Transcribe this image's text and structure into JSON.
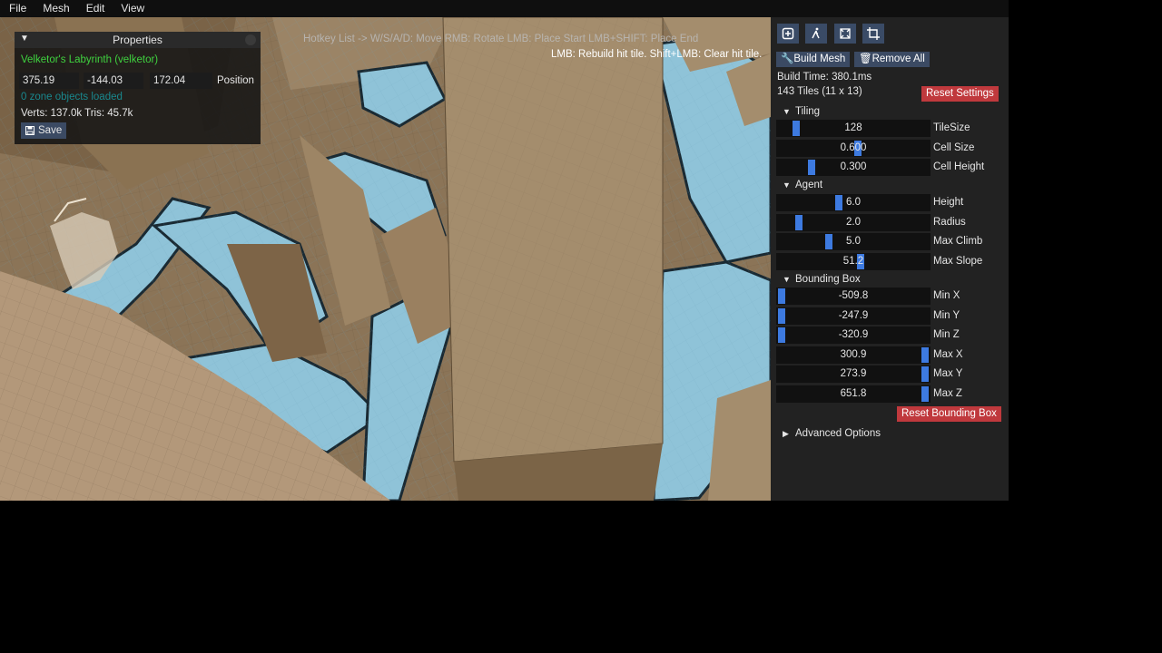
{
  "menu": [
    "File",
    "Mesh",
    "Edit",
    "View"
  ],
  "viewport": {
    "hint_top": "Hotkey List -> W/S/A/D: Move  RMB: Rotate  LMB: Place Start  LMB+SHIFT: Place End",
    "hint_tool": "LMB: Rebuild hit tile.  Shift+LMB: Clear hit tile."
  },
  "properties": {
    "title": "Properties",
    "zone_name": "Velketor's Labyrinth (velketor)",
    "pos_x": "375.19",
    "pos_y": "-144.03",
    "pos_z": "172.04",
    "position_label": "Position",
    "zone_objects": "0 zone objects loaded",
    "stats": "Verts: 137.0k Tris: 45.7k",
    "save_label": "Save"
  },
  "panel": {
    "build_mesh": "Build Mesh",
    "remove_all": "Remove All",
    "build_time": "Build Time: 380.1ms",
    "tiles": "143 Tiles (11 x 13)",
    "reset_settings": "Reset Settings",
    "tiling_header": "Tiling",
    "agent_header": "Agent",
    "bbox_header": "Bounding Box",
    "reset_bbox": "Reset Bounding Box",
    "advanced": "Advanced Options",
    "tiling": [
      {
        "label": "TileSize",
        "value": "128",
        "fraction": 0.1
      },
      {
        "label": "Cell Size",
        "value": "0.600",
        "fraction": 0.53
      },
      {
        "label": "Cell Height",
        "value": "0.300",
        "fraction": 0.21
      }
    ],
    "agent": [
      {
        "label": "Height",
        "value": "6.0",
        "fraction": 0.4
      },
      {
        "label": "Radius",
        "value": "2.0",
        "fraction": 0.12
      },
      {
        "label": "Max Climb",
        "value": "5.0",
        "fraction": 0.33
      },
      {
        "label": "Max Slope",
        "value": "51.2",
        "fraction": 0.55
      }
    ],
    "bbox": [
      {
        "label": "Min X",
        "value": "-509.8",
        "fraction": 0.0
      },
      {
        "label": "Min Y",
        "value": "-247.9",
        "fraction": 0.0
      },
      {
        "label": "Min Z",
        "value": "-320.9",
        "fraction": 0.0
      },
      {
        "label": "Max X",
        "value": "300.9",
        "fraction": 1.0
      },
      {
        "label": "Max Y",
        "value": "273.9",
        "fraction": 1.0
      },
      {
        "label": "Max Z",
        "value": "651.8",
        "fraction": 1.0
      }
    ]
  },
  "colors": {
    "accent": "#3d7ae0",
    "danger": "#c0393d",
    "zone_green": "#3fd23f",
    "zone_objects_teal": "#19888e",
    "navmesh": "#8fc3d8",
    "wall": "#a08a6a"
  }
}
